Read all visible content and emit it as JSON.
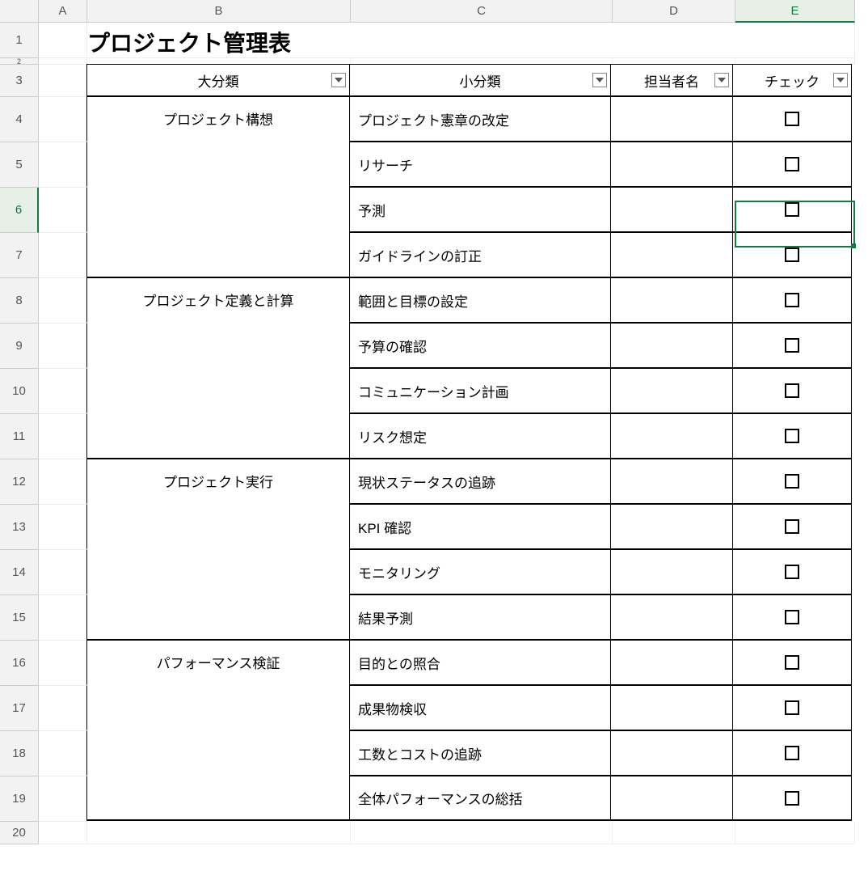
{
  "columns": [
    "A",
    "B",
    "C",
    "D",
    "E"
  ],
  "title": "プロジェクト管理表",
  "headers": {
    "b": "大分類",
    "c": "小分類",
    "d": "担当者名",
    "e": "チェック"
  },
  "groups": [
    {
      "category": "プロジェクト構想",
      "items": [
        "プロジェクト憲章の改定",
        "リサーチ",
        "予測",
        "ガイドラインの訂正"
      ]
    },
    {
      "category": "プロジェクト定義と計算",
      "items": [
        "範囲と目標の設定",
        "予算の確認",
        "コミュニケーション計画",
        "リスク想定"
      ]
    },
    {
      "category": "プロジェクト実行",
      "items": [
        "現状ステータスの追跡",
        "KPI  確認",
        "モニタリング",
        "結果予測"
      ]
    },
    {
      "category": "パフォーマンス検証",
      "items": [
        "目的との照合",
        "成果物検収",
        "工数とコストの追跡",
        "全体パフォーマンスの総括"
      ]
    }
  ],
  "selectedCell": "E6",
  "rowLabels": [
    "1",
    "2",
    "3",
    "4",
    "5",
    "6",
    "7",
    "8",
    "9",
    "10",
    "11",
    "12",
    "13",
    "14",
    "15",
    "16",
    "17",
    "18",
    "19",
    "20"
  ]
}
